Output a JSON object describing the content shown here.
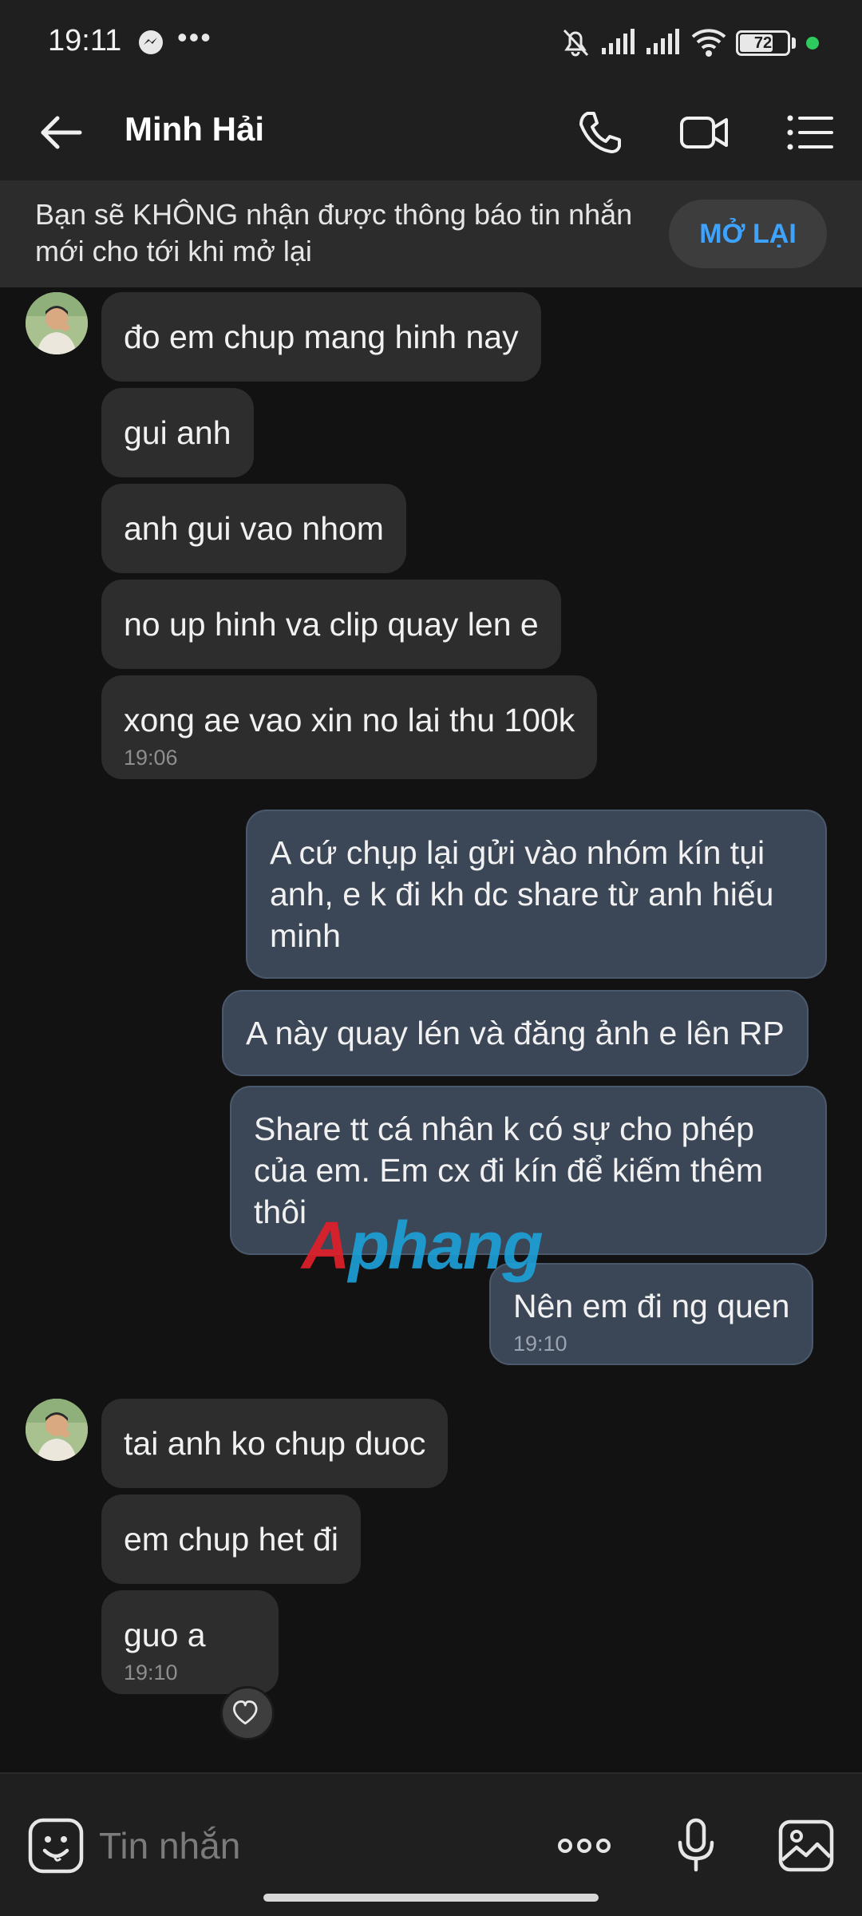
{
  "status_bar": {
    "time": "19:11",
    "more": "•••",
    "battery": "72",
    "battery_level": 0.72
  },
  "header": {
    "contact_name": "Minh Hải"
  },
  "mute_banner": {
    "text": "Bạn sẽ KHÔNG nhận được thông báo tin nhắn mới cho tới khi mở lại",
    "button_label": "MỞ LẠI"
  },
  "messages": {
    "m0": {
      "text": "đo em chup mang hinh nay"
    },
    "m1": {
      "text": "gui anh"
    },
    "m2": {
      "text": "anh gui vao nhom"
    },
    "m3": {
      "text": "no up hinh va clip quay len e"
    },
    "m4": {
      "text": "xong ae vao xin no lai thu 100k",
      "time": "19:06"
    },
    "m5": {
      "text": "A cứ chụp lại gửi vào nhóm kín tụi anh, e k đi kh dc share từ anh hiếu minh"
    },
    "m6": {
      "text": "A này quay lén và đăng ảnh e lên RP"
    },
    "m7": {
      "text": "Share tt cá nhân k có sự cho phép của em. Em cx đi kín để kiếm thêm thôi"
    },
    "m8": {
      "text": "Nên em đi ng quen",
      "time": "19:10"
    },
    "m9": {
      "text": "tai anh ko chup duoc"
    },
    "m10": {
      "text": "em chup het đi"
    },
    "m11": {
      "text": "guo a",
      "time": "19:10"
    }
  },
  "watermark": {
    "part1": "A",
    "part2": "phang"
  },
  "input_bar": {
    "placeholder": "Tin nhắn"
  },
  "colors": {
    "background": "#121212",
    "incoming_bubble": "#2d2d2d",
    "outgoing_bubble": "#3b4656",
    "accent": "#3ea3ff"
  }
}
